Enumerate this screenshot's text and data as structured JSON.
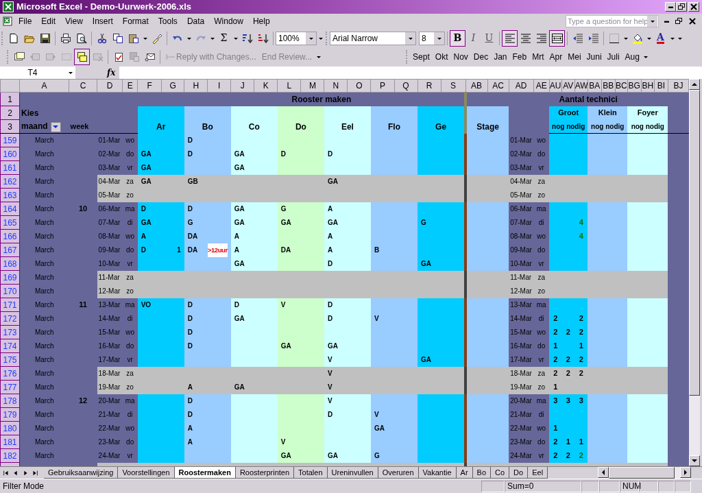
{
  "window": {
    "title": "Microsoft Excel - Demo-Uurwerk-2006.xls"
  },
  "menu": [
    "File",
    "Edit",
    "View",
    "Insert",
    "Format",
    "Tools",
    "Data",
    "Window",
    "Help"
  ],
  "help_box": {
    "placeholder": "Type a question for help"
  },
  "standard_toolbar": {
    "undo": {
      "disabled": false
    },
    "redo": {
      "disabled": true
    },
    "autosum": "Σ",
    "zoom": "100%"
  },
  "formatting_toolbar": {
    "font": "Arial Narrow",
    "size": "8",
    "bold": {
      "label": "B",
      "pressed": true
    },
    "italic": {
      "label": "I",
      "pressed": false
    },
    "underline": {
      "label": "U",
      "pressed": false
    },
    "align_left": {
      "pressed": true
    },
    "center": {
      "pressed": false
    },
    "align_right": {
      "pressed": false
    },
    "merge": {
      "pressed": true
    },
    "font_color": "A"
  },
  "reviewing_toolbar": {
    "comments": [
      {
        "pressed": false,
        "disabled": false
      },
      {
        "pressed": false,
        "disabled": true
      },
      {
        "pressed": false,
        "disabled": true
      },
      {
        "pressed": false,
        "disabled": true
      },
      {
        "pressed": true,
        "disabled": false
      },
      {
        "pressed": false,
        "disabled": true
      }
    ],
    "review_tools": [
      {
        "disabled": false
      },
      {
        "disabled": true
      },
      {
        "disabled": false
      }
    ],
    "reply": {
      "label": "Reply with Changes...",
      "disabled": true
    },
    "end_review": {
      "label": "End Review...",
      "disabled": true
    }
  },
  "month_toolbar": [
    "Sept",
    "Okt",
    "Nov",
    "Dec",
    "Jan",
    "Feb",
    "Mrt",
    "Apr",
    "Mei",
    "Juni",
    "Juli",
    "Aug"
  ],
  "formula_bar": {
    "name_box": "T4",
    "fx": "fx"
  },
  "columns": [
    "A",
    "C",
    "D",
    "E",
    "F",
    "G",
    "H",
    "I",
    "J",
    "K",
    "L",
    "M",
    "N",
    "O",
    "P",
    "Q",
    "R",
    "S",
    "AB",
    "AC",
    "AD",
    "AE",
    "AU",
    "AV",
    "AW",
    "BA",
    "BB",
    "BC",
    "BG",
    "BH",
    "BI",
    "BJ"
  ],
  "header": {
    "row_1": "1",
    "row_2": "2",
    "row_3": "3",
    "title": "Rooster maken",
    "tech_title": "Aantal technici",
    "kies": "Kies",
    "maand": "maand",
    "week": "week"
  },
  "staff": [
    {
      "name": "Ar",
      "color": "#00ccff"
    },
    {
      "name": "Bo",
      "color": "#99ccff"
    },
    {
      "name": "Co",
      "color": "#ccffff"
    },
    {
      "name": "Do",
      "color": "#ccffcc"
    },
    {
      "name": "Eel",
      "color": "#ccffff"
    },
    {
      "name": "Flo",
      "color": "#99ccff"
    },
    {
      "name": "Ge",
      "color": "#00ccff"
    }
  ],
  "stage": {
    "name": "Stage",
    "color": "#99ccff"
  },
  "tech_groups": [
    {
      "name": "Groot",
      "sub": "nog nodig",
      "color": "#00ccff"
    },
    {
      "name": "Klein",
      "sub": "nog nodig",
      "color": "#99ccff"
    },
    {
      "name": "Foyer",
      "sub": "nog nodig",
      "color": "#ccffff"
    }
  ],
  "rows": [
    {
      "row": "159",
      "month": "March",
      "date": "01-Mar",
      "day": "wo",
      "weekend": false,
      "roster": {
        "H": "D"
      },
      "tech_date": "01-Mar",
      "tech_day": "wo"
    },
    {
      "row": "160",
      "month": "March",
      "date": "02-Mar",
      "day": "do",
      "weekend": false,
      "roster": {
        "F": "GA",
        "H": "D",
        "J": "GA",
        "L": "D",
        "N": "D"
      },
      "tech_date": "02-Mar",
      "tech_day": "do"
    },
    {
      "row": "161",
      "month": "March",
      "date": "03-Mar",
      "day": "vr",
      "weekend": false,
      "roster": {
        "F": "GA",
        "J": "GA"
      },
      "tech_date": "03-Mar",
      "tech_day": "vr"
    },
    {
      "row": "162",
      "month": "March",
      "date": "04-Mar",
      "day": "za",
      "weekend": true,
      "roster": {
        "F": "GA",
        "H": "GB",
        "N": "GA"
      },
      "tech_date": "04-Mar",
      "tech_day": "za"
    },
    {
      "row": "163",
      "month": "March",
      "date": "05-Mar",
      "day": "zo",
      "weekend": true,
      "tech_date": "05-Mar",
      "tech_day": "zo"
    },
    {
      "row": "164",
      "month": "March",
      "week": "10",
      "date": "06-Mar",
      "day": "ma",
      "weekend": false,
      "roster": {
        "F": "D",
        "H": "D",
        "J": "GA",
        "L": "G",
        "N": "A"
      },
      "tech_date": "06-Mar",
      "tech_day": "ma"
    },
    {
      "row": "165",
      "month": "March",
      "date": "07-Mar",
      "day": "di",
      "weekend": false,
      "roster": {
        "F": "GA",
        "H": "G",
        "J": "GA",
        "L": "GA",
        "N": "GA",
        "R": "G"
      },
      "tech_date": "07-Mar",
      "tech_day": "di",
      "counts": {
        "AW": {
          "text": "4",
          "kind": "met"
        }
      }
    },
    {
      "row": "166",
      "month": "March",
      "date": "08-Mar",
      "day": "wo",
      "weekend": false,
      "roster": {
        "F": "A",
        "H": "DA",
        "J": "A",
        "N": "A"
      },
      "tech_date": "08-Mar",
      "tech_day": "wo",
      "counts": {
        "AW": {
          "text": "4",
          "kind": "met"
        }
      }
    },
    {
      "row": "167",
      "month": "March",
      "date": "09-Mar",
      "day": "do",
      "weekend": false,
      "roster": {
        "F": "D",
        "G": {
          "text": "1",
          "kind": "number"
        },
        "H": "DA",
        "I": {
          "text": ">12uur",
          "kind": "warning"
        },
        "J": "A",
        "L": "DA",
        "N": "A",
        "P": "B"
      },
      "tech_date": "09-Mar",
      "tech_day": "do"
    },
    {
      "row": "168",
      "month": "March",
      "date": "10-Mar",
      "day": "vr",
      "weekend": false,
      "roster": {
        "J": "GA",
        "N": "D",
        "R": "GA"
      },
      "tech_date": "10-Mar",
      "tech_day": "vr"
    },
    {
      "row": "169",
      "month": "March",
      "date": "11-Mar",
      "day": "za",
      "weekend": true,
      "tech_date": "11-Mar",
      "tech_day": "za"
    },
    {
      "row": "170",
      "month": "March",
      "date": "12-Mar",
      "day": "zo",
      "weekend": true,
      "tech_date": "12-Mar",
      "tech_day": "zo"
    },
    {
      "row": "171",
      "month": "March",
      "week": "11",
      "date": "13-Mar",
      "day": "ma",
      "weekend": false,
      "roster": {
        "F": "VO",
        "H": "D",
        "J": "D",
        "L": "V",
        "N": "D"
      },
      "tech_date": "13-Mar",
      "tech_day": "ma"
    },
    {
      "row": "172",
      "month": "March",
      "date": "14-Mar",
      "day": "di",
      "weekend": false,
      "roster": {
        "H": "D",
        "J": "GA",
        "N": "D",
        "P": "V"
      },
      "tech_date": "14-Mar",
      "tech_day": "di",
      "counts": {
        "AU": "2",
        "AW": "2"
      }
    },
    {
      "row": "173",
      "month": "March",
      "date": "15-Mar",
      "day": "wo",
      "weekend": false,
      "roster": {
        "H": "D"
      },
      "tech_date": "15-Mar",
      "tech_day": "wo",
      "counts": {
        "AU": "2",
        "AV": "2",
        "AW": "2"
      }
    },
    {
      "row": "174",
      "month": "March",
      "date": "16-Mar",
      "day": "do",
      "weekend": false,
      "roster": {
        "H": "D",
        "L": "GA",
        "N": "GA"
      },
      "tech_date": "16-Mar",
      "tech_day": "do",
      "counts": {
        "AU": "1",
        "AW": "1"
      }
    },
    {
      "row": "175",
      "month": "March",
      "date": "17-Mar",
      "day": "vr",
      "weekend": false,
      "roster": {
        "N": "V",
        "R": "GA"
      },
      "tech_date": "17-Mar",
      "tech_day": "vr",
      "counts": {
        "AU": "2",
        "AV": "2",
        "AW": "2"
      }
    },
    {
      "row": "176",
      "month": "March",
      "date": "18-Mar",
      "day": "za",
      "weekend": true,
      "roster": {
        "N": "V"
      },
      "tech_date": "18-Mar",
      "tech_day": "za",
      "counts": {
        "AU": "2",
        "AV": "2",
        "AW": "2"
      }
    },
    {
      "row": "177",
      "month": "March",
      "date": "19-Mar",
      "day": "zo",
      "weekend": true,
      "roster": {
        "H": "A",
        "J": "GA",
        "N": "V"
      },
      "tech_date": "19-Mar",
      "tech_day": "zo",
      "counts": {
        "AU": "1"
      }
    },
    {
      "row": "178",
      "month": "March",
      "week": "12",
      "date": "20-Mar",
      "day": "ma",
      "weekend": false,
      "roster": {
        "H": "D",
        "N": "V"
      },
      "tech_date": "20-Mar",
      "tech_day": "ma",
      "counts": {
        "AU": "3",
        "AV": "3",
        "AW": "3"
      }
    },
    {
      "row": "179",
      "month": "March",
      "date": "21-Mar",
      "day": "di",
      "weekend": false,
      "roster": {
        "H": "D",
        "N": "D",
        "P": "V"
      },
      "tech_date": "21-Mar",
      "tech_day": "di"
    },
    {
      "row": "180",
      "month": "March",
      "date": "22-Mar",
      "day": "wo",
      "weekend": false,
      "roster": {
        "H": "A",
        "P": "GA"
      },
      "tech_date": "22-Mar",
      "tech_day": "wo",
      "counts": {
        "AU": "1"
      }
    },
    {
      "row": "181",
      "month": "March",
      "date": "23-Mar",
      "day": "do",
      "weekend": false,
      "roster": {
        "H": "A",
        "L": "V"
      },
      "tech_date": "23-Mar",
      "tech_day": "do",
      "counts": {
        "AU": "2",
        "AV": "1",
        "AW": "1"
      }
    },
    {
      "row": "182",
      "month": "March",
      "date": "24-Mar",
      "day": "vr",
      "weekend": false,
      "roster": {
        "L": "GA",
        "N": "GA",
        "P": "G"
      },
      "tech_date": "24-Mar",
      "tech_day": "vr",
      "counts": {
        "AU": "2",
        "AV": "2",
        "AW": {
          "text": "2",
          "kind": "met"
        }
      }
    }
  ],
  "sheet_tabs": [
    {
      "label": "Gebruiksaanwijzing",
      "selected": false
    },
    {
      "label": "Voorstellingen",
      "selected": false
    },
    {
      "label": "Roostermaken",
      "selected": true
    },
    {
      "label": "Roosterprinten",
      "selected": false
    },
    {
      "label": "Totalen",
      "selected": false
    },
    {
      "label": "Ureninvullen",
      "selected": false
    },
    {
      "label": "Overuren",
      "selected": false
    },
    {
      "label": "Vakantie",
      "selected": false
    },
    {
      "label": "Ar",
      "selected": false
    },
    {
      "label": "Bo",
      "selected": false
    },
    {
      "label": "Co",
      "selected": false
    },
    {
      "label": "Do",
      "selected": false
    },
    {
      "label": "Eel",
      "selected": false
    }
  ],
  "status_bar": {
    "mode": "Filter Mode",
    "sum": "Sum=0",
    "num": "NUM"
  }
}
